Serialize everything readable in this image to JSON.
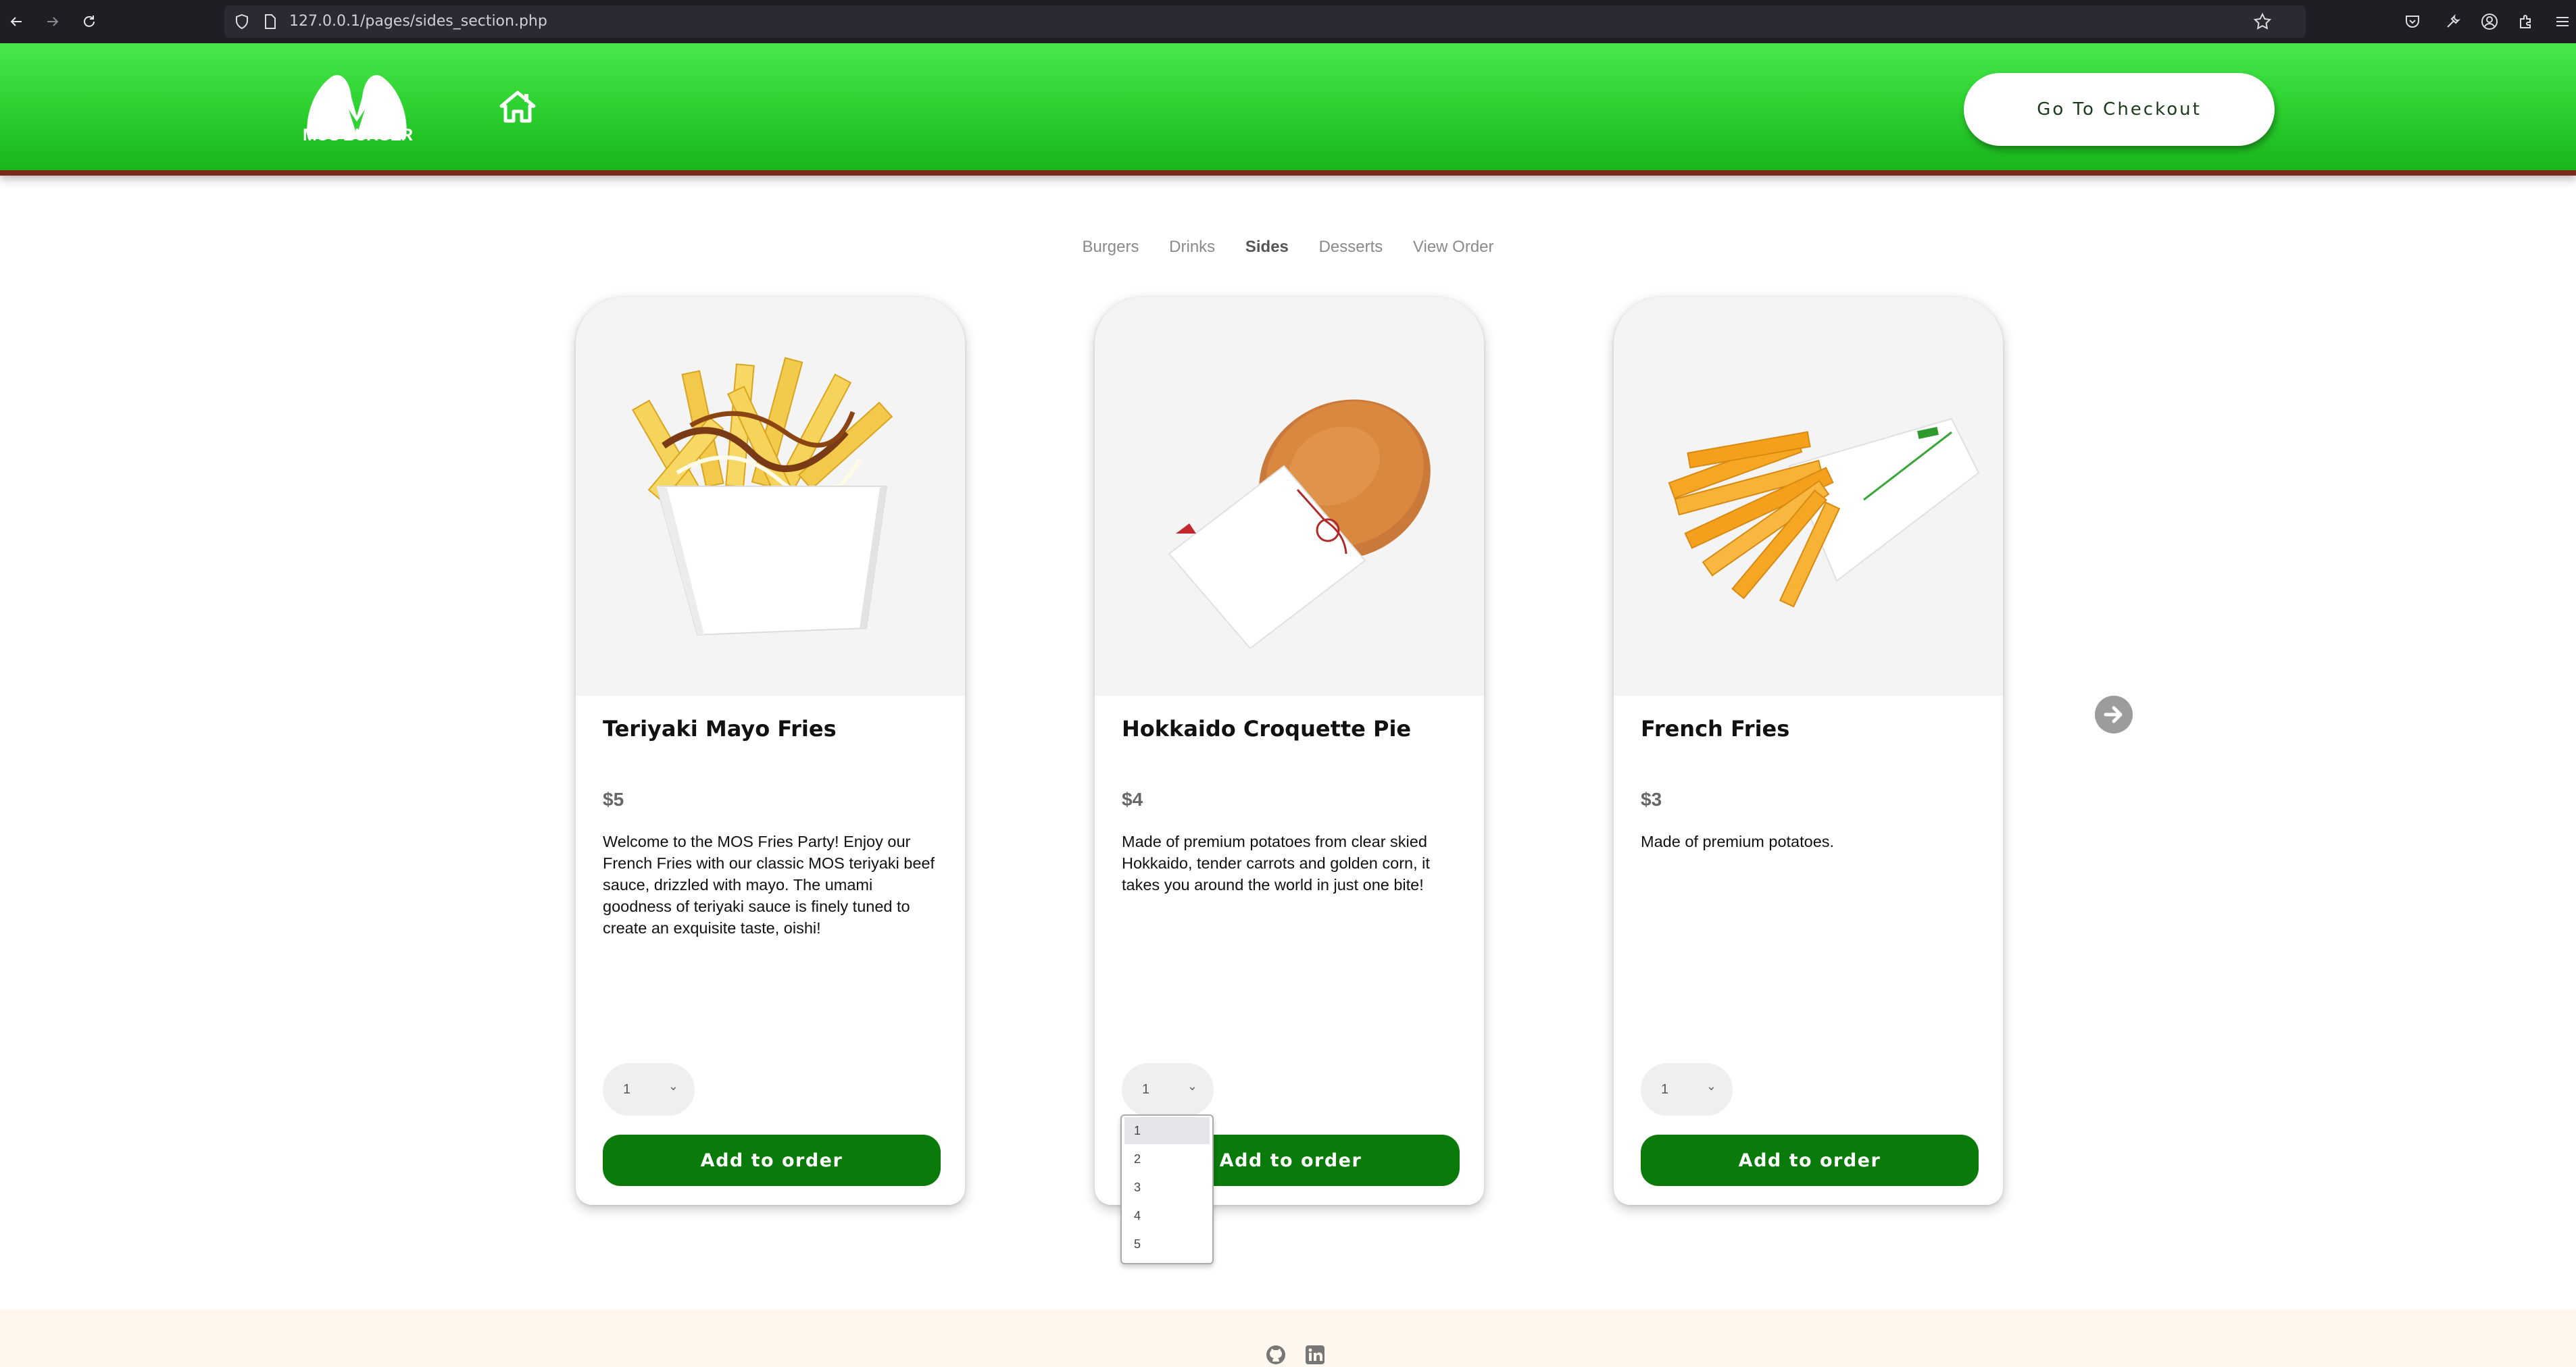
{
  "browser": {
    "url": "127.0.0.1/pages/sides_section.php"
  },
  "header": {
    "logo_text": "MOS BURGER",
    "checkout_label": "Go To Checkout"
  },
  "nav": {
    "items": [
      "Burgers",
      "Drinks",
      "Sides",
      "Desserts",
      "View Order"
    ],
    "active": "Sides"
  },
  "products": [
    {
      "name": "Teriyaki Mayo Fries",
      "price": "$5",
      "description": "Welcome to the MOS Fries Party! Enjoy our French Fries with our classic MOS teriyaki beef sauce, drizzled with mayo. The umami goodness of teriyaki sauce is finely tuned to create an exquisite taste, oishi!",
      "quantity": "1",
      "add_label": "Add to order"
    },
    {
      "name": "Hokkaido Croquette Pie",
      "price": "$4",
      "description": "Made of premium potatoes from clear skied Hokkaido, tender carrots and golden corn, it takes you around the world in just one bite!",
      "quantity": "1",
      "add_label": "Add to order"
    },
    {
      "name": "French Fries",
      "price": "$3",
      "description": "Made of premium potatoes.",
      "quantity": "1",
      "add_label": "Add to order"
    }
  ],
  "quantity_dropdown": {
    "options": [
      "1",
      "2",
      "3",
      "4",
      "5"
    ],
    "selected": "1"
  },
  "colors": {
    "header_green": "#2fd432",
    "button_green": "#0a7a0a",
    "header_border": "#7a2a1a"
  }
}
